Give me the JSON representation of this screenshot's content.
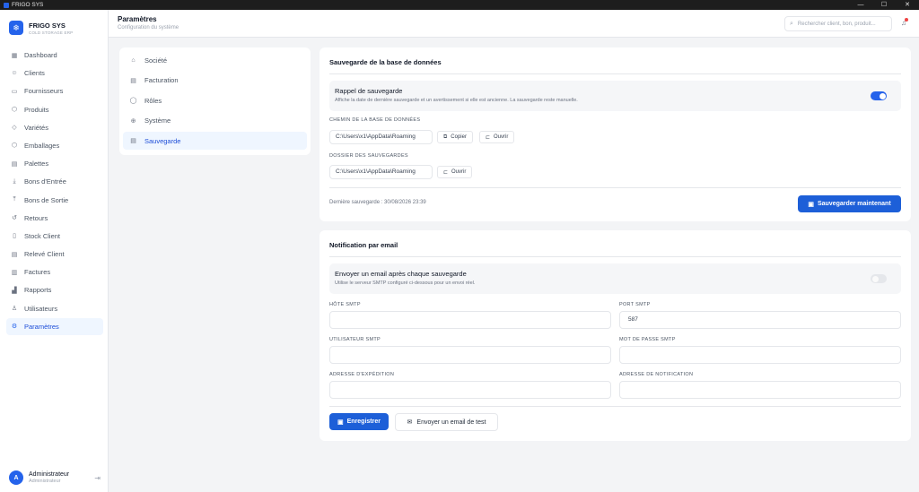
{
  "window": {
    "title": "FRIGO SYS",
    "controls": [
      "—",
      "☐",
      "✕"
    ]
  },
  "brand": {
    "name": "FRIGO SYS",
    "subtitle": "COLD STORAGE ERP"
  },
  "sidebar": {
    "items": [
      {
        "label": "Dashboard",
        "icon": "dashboard-icon",
        "glyph": "▦"
      },
      {
        "label": "Clients",
        "icon": "users-icon",
        "glyph": "☺"
      },
      {
        "label": "Fournisseurs",
        "icon": "truck-icon",
        "glyph": "▭"
      },
      {
        "label": "Produits",
        "icon": "box-icon",
        "glyph": "⬡"
      },
      {
        "label": "Variétés",
        "icon": "tag-icon",
        "glyph": "◇"
      },
      {
        "label": "Emballages",
        "icon": "package-icon",
        "glyph": "⬡"
      },
      {
        "label": "Palettes",
        "icon": "pallet-icon",
        "glyph": "▤"
      },
      {
        "label": "Bons d'Entrée",
        "icon": "download-icon",
        "glyph": "⤓"
      },
      {
        "label": "Bons de Sortie",
        "icon": "upload-icon",
        "glyph": "⤒"
      },
      {
        "label": "Retours",
        "icon": "return-icon",
        "glyph": "↺"
      },
      {
        "label": "Stock Client",
        "icon": "stock-icon",
        "glyph": "▯"
      },
      {
        "label": "Relevé Client",
        "icon": "statement-icon",
        "glyph": "▤"
      },
      {
        "label": "Factures",
        "icon": "invoice-icon",
        "glyph": "▥"
      },
      {
        "label": "Rapports",
        "icon": "chart-icon",
        "glyph": "▟"
      },
      {
        "label": "Utilisateurs",
        "icon": "user-icon",
        "glyph": "♙"
      },
      {
        "label": "Paramètres",
        "icon": "gear-icon",
        "glyph": "⚙",
        "active": true
      }
    ]
  },
  "user": {
    "initial": "A",
    "name": "Administrateur",
    "role": "Administrateur"
  },
  "header": {
    "title": "Paramètres",
    "subtitle": "Configuration du système",
    "search_placeholder": "Rechercher client, bon, produit..."
  },
  "settings_nav": {
    "items": [
      {
        "label": "Société",
        "icon": "building-icon",
        "glyph": "⌂"
      },
      {
        "label": "Facturation",
        "icon": "receipt-icon",
        "glyph": "▤"
      },
      {
        "label": "Rôles",
        "icon": "shield-icon",
        "glyph": "◯"
      },
      {
        "label": "Système",
        "icon": "globe-icon",
        "glyph": "⊕"
      },
      {
        "label": "Sauvegarde",
        "icon": "database-icon",
        "glyph": "▤",
        "active": true
      }
    ]
  },
  "backup": {
    "title": "Sauvegarde de la base de données",
    "reminder_title": "Rappel de sauvegarde",
    "reminder_desc": "Affiche la date de dernière sauvegarde et un avertissement si elle est ancienne. La sauvegarde reste manuelle.",
    "reminder_enabled": true,
    "db_path_label": "CHEMIN DE LA BASE DE DONNÉES",
    "db_path": "C:\\Users\\x1\\AppData\\Roaming",
    "copy_label": "Copier",
    "open_label": "Ouvrir",
    "folder_label": "DOSSIER DES SAUVEGARDES",
    "folder_path": "C:\\Users\\x1\\AppData\\Roaming",
    "folder_open_label": "Ouvrir",
    "last_backup": "Dernière sauvegarde : 30/08/2026 23:39",
    "save_now_label": "Sauvegarder maintenant"
  },
  "email": {
    "title": "Notification par email",
    "toggle_title": "Envoyer un email après chaque sauvegarde",
    "toggle_desc": "Utilise le serveur SMTP configuré ci-dessous pour un envoi réel.",
    "toggle_enabled": false,
    "smtp_host_label": "HÔTE SMTP",
    "smtp_host": "",
    "smtp_port_label": "PORT SMTP",
    "smtp_port": "587",
    "smtp_user_label": "UTILISATEUR SMTP",
    "smtp_user": "",
    "smtp_pass_label": "MOT DE PASSE SMTP",
    "smtp_pass": "",
    "from_label": "ADRESSE D'EXPÉDITION",
    "from": "",
    "notify_label": "ADRESSE DE NOTIFICATION",
    "notify": "",
    "save_label": "Enregistrer",
    "test_label": "Envoyer un email de test"
  },
  "colors": {
    "accent": "#1d5fd8",
    "active_bg": "#eff6ff",
    "badge": "#ef4444"
  }
}
